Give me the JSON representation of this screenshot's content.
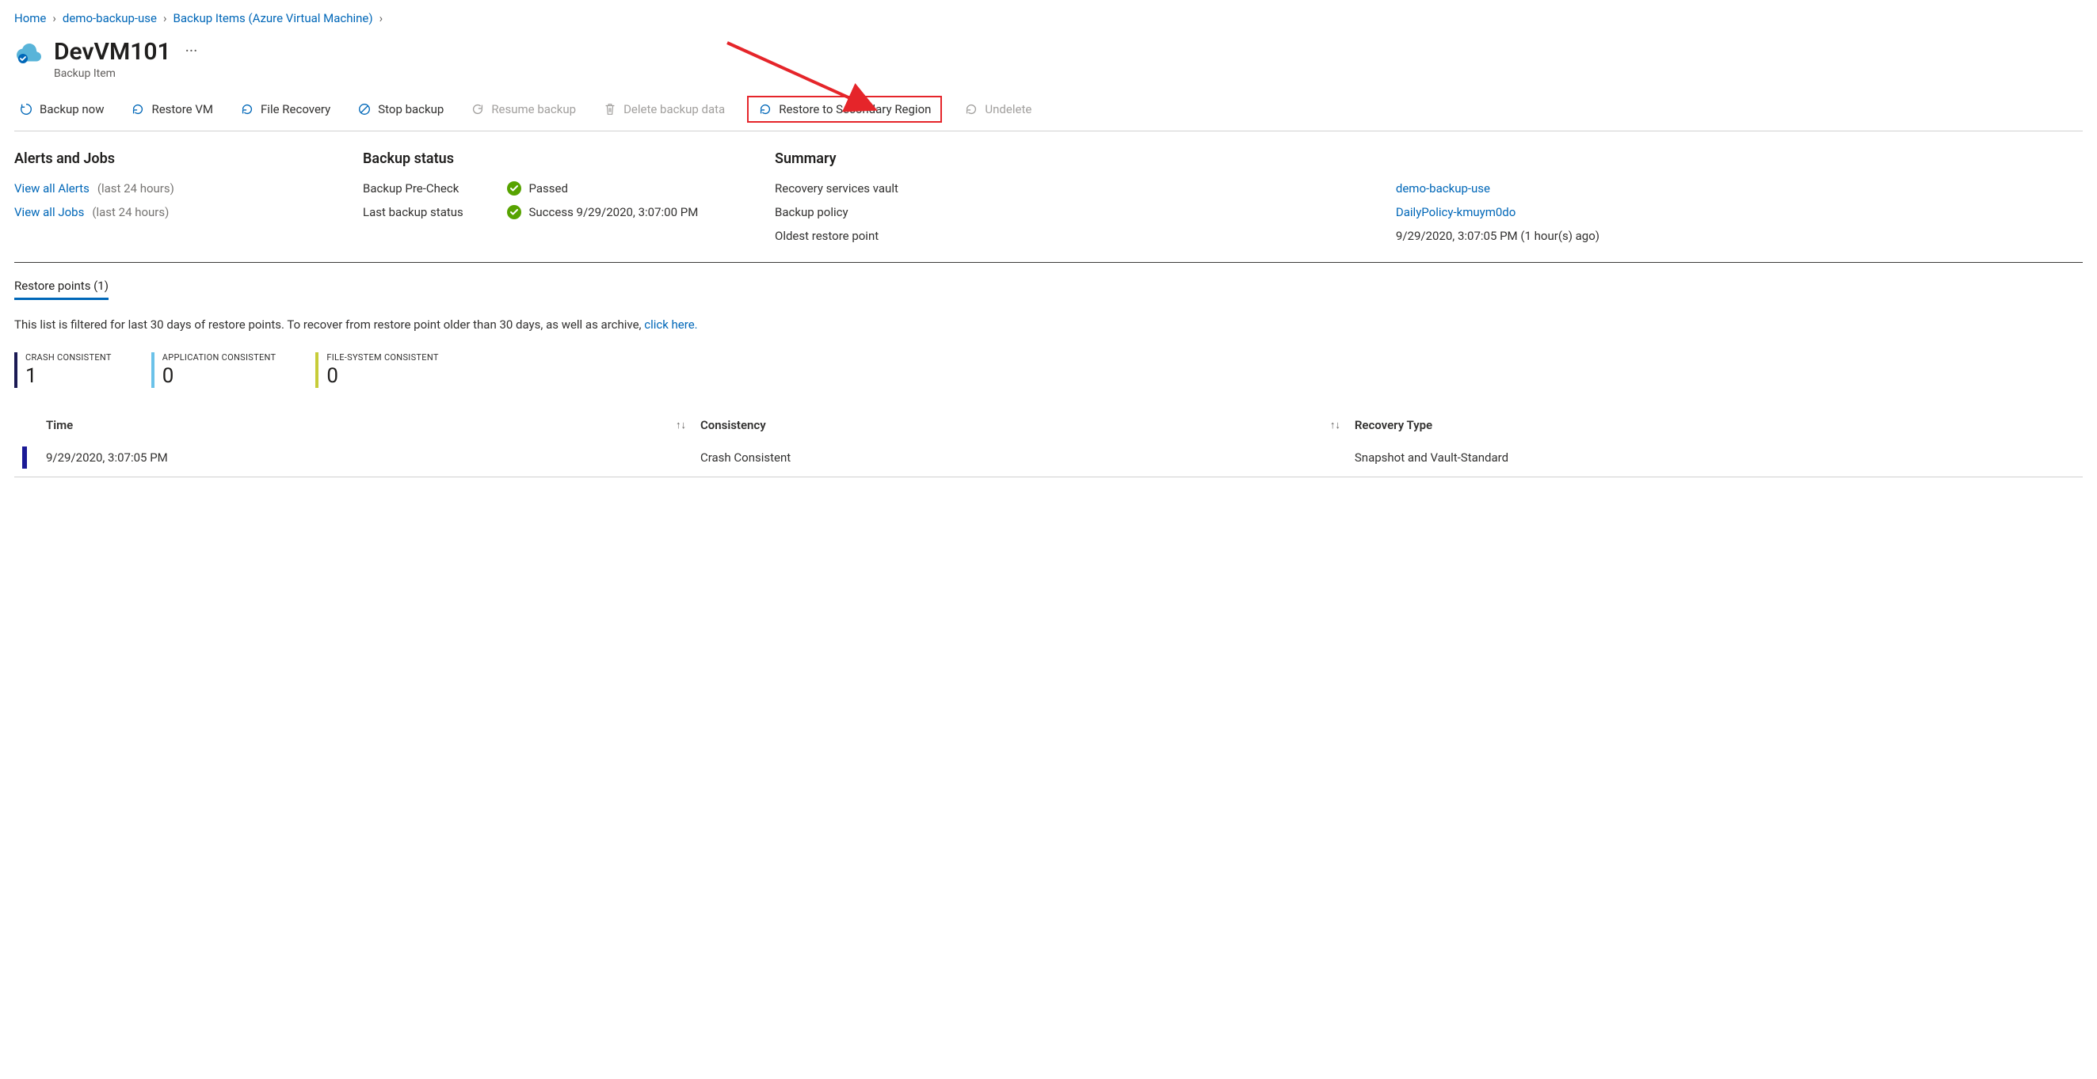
{
  "breadcrumb": {
    "home": "Home",
    "vault": "demo-backup-use",
    "items": "Backup Items (Azure Virtual Machine)"
  },
  "header": {
    "title": "DevVM101",
    "subtitle": "Backup Item"
  },
  "toolbar": {
    "backup_now": "Backup now",
    "restore_vm": "Restore VM",
    "file_recovery": "File Recovery",
    "stop_backup": "Stop backup",
    "resume_backup": "Resume backup",
    "delete_backup": "Delete backup data",
    "restore_secondary": "Restore to Secondary Region",
    "undelete": "Undelete"
  },
  "alerts": {
    "heading": "Alerts and Jobs",
    "view_alerts": "View all Alerts",
    "alerts_period": "(last 24 hours)",
    "view_jobs": "View all Jobs",
    "jobs_period": "(last 24 hours)"
  },
  "backup_status": {
    "heading": "Backup status",
    "precheck_label": "Backup Pre-Check",
    "precheck_value": "Passed",
    "last_label": "Last backup status",
    "last_value": "Success 9/29/2020, 3:07:00 PM"
  },
  "summary": {
    "heading": "Summary",
    "vault_label": "Recovery services vault",
    "vault_value": "demo-backup-use",
    "policy_label": "Backup policy",
    "policy_value": "DailyPolicy-kmuym0do",
    "oldest_label": "Oldest restore point",
    "oldest_value": "9/29/2020, 3:07:05 PM (1 hour(s) ago)"
  },
  "tabs": {
    "restore_points": "Restore points (1)"
  },
  "filter_note": {
    "text": "This list is filtered for last 30 days of restore points. To recover from restore point older than 30 days, as well as archive, ",
    "link": "click here."
  },
  "stats": {
    "crash_label": "CRASH CONSISTENT",
    "crash_value": "1",
    "app_label": "APPLICATION CONSISTENT",
    "app_value": "0",
    "fs_label": "FILE-SYSTEM CONSISTENT",
    "fs_value": "0"
  },
  "table": {
    "col_time": "Time",
    "col_consistency": "Consistency",
    "col_recovery": "Recovery Type",
    "rows": [
      {
        "time": "9/29/2020, 3:07:05 PM",
        "consistency": "Crash Consistent",
        "recovery": "Snapshot and Vault-Standard"
      }
    ]
  }
}
